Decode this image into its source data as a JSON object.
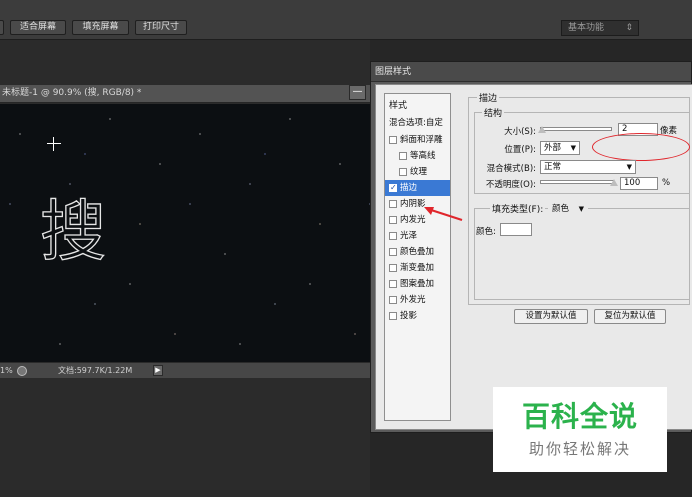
{
  "toolbar": {
    "fit_screen": "适合屏幕",
    "fill_screen": "填充屏幕",
    "print_size": "打印尺寸",
    "workspace": "基本功能",
    "workspace_arrow": "⇕"
  },
  "document": {
    "tab_title": "未标题-1 @ 90.9% (搜, RGB/8) *",
    "minimize_glyph": "—",
    "glyph": "搜"
  },
  "status": {
    "zoom": "1%",
    "doc_info": "文档:597.7K/1.22M",
    "play": "▶"
  },
  "dialog": {
    "title": "图层样式",
    "styles_header": "样式",
    "blend_options": "混合选项:自定",
    "items": [
      {
        "label": "斜面和浮雕",
        "checked": false,
        "indent": 0
      },
      {
        "label": "等高线",
        "checked": false,
        "indent": 1
      },
      {
        "label": "纹理",
        "checked": false,
        "indent": 1
      },
      {
        "label": "描边",
        "checked": true,
        "indent": 0,
        "active": true
      },
      {
        "label": "内阴影",
        "checked": false,
        "indent": 0
      },
      {
        "label": "内发光",
        "checked": false,
        "indent": 0
      },
      {
        "label": "光泽",
        "checked": false,
        "indent": 0
      },
      {
        "label": "颜色叠加",
        "checked": false,
        "indent": 0
      },
      {
        "label": "渐变叠加",
        "checked": false,
        "indent": 0
      },
      {
        "label": "图案叠加",
        "checked": false,
        "indent": 0
      },
      {
        "label": "外发光",
        "checked": false,
        "indent": 0
      },
      {
        "label": "投影",
        "checked": false,
        "indent": 0
      }
    ],
    "stroke": {
      "group_title": "描边",
      "structure_title": "结构",
      "size_label": "大小(S):",
      "size_value": "2",
      "size_unit": "像素",
      "position_label": "位置(P):",
      "position_value": "外部",
      "blend_label": "混合模式(B):",
      "blend_value": "正常",
      "opacity_label": "不透明度(O):",
      "opacity_value": "100",
      "opacity_unit": "%",
      "fill_type_label": "填充类型(F):",
      "fill_type_value": "颜色",
      "color_label": "颜色:",
      "color_value": "#ffffff",
      "make_default": "设置为默认值",
      "reset_default": "复位为默认值"
    }
  },
  "watermark": {
    "main": "百科全说",
    "sub": "助你轻松解决"
  },
  "colors": {
    "active_item": "#3a79d4",
    "annotation": "#e0262c",
    "watermark_green": "#2bb24c"
  }
}
